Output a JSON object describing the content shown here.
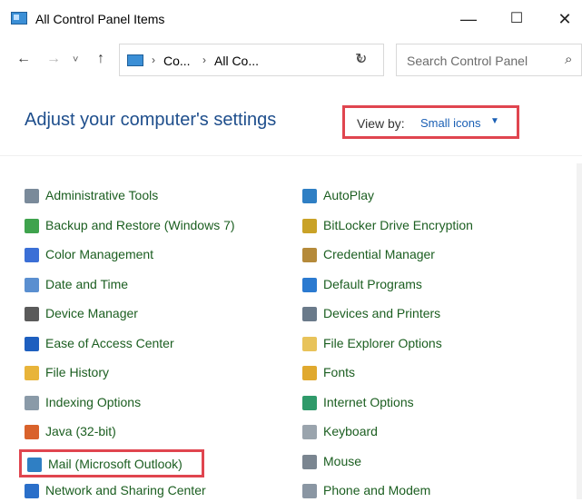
{
  "window": {
    "title": "All Control Panel Items",
    "minimize_glyph": "—",
    "maximize_glyph": "☐",
    "close_glyph": "✕"
  },
  "nav": {
    "back_glyph": "←",
    "forward_glyph": "→",
    "recent_glyph": "˅",
    "up_glyph": "↑",
    "breadcrumbs": [
      "Co...",
      "All Co..."
    ],
    "separator": "›",
    "dropdown_glyph": "˅",
    "refresh_glyph": "↻",
    "search_placeholder": "Search Control Panel",
    "search_glyph": "⌕"
  },
  "header": {
    "title": "Adjust your computer's settings",
    "view_by_label": "View by:",
    "view_by_value": "Small icons",
    "view_by_caret": "▼"
  },
  "accent_color": "#e0454f",
  "items_left": [
    {
      "label": "Administrative Tools",
      "icon": "administrative-tools-icon",
      "color": "#7a8a9a"
    },
    {
      "label": "Backup and Restore (Windows 7)",
      "icon": "backup-restore-icon",
      "color": "#3fa34d"
    },
    {
      "label": "Color Management",
      "icon": "color-management-icon",
      "color": "#3b6fd6"
    },
    {
      "label": "Date and Time",
      "icon": "date-time-icon",
      "color": "#5a8fd0"
    },
    {
      "label": "Device Manager",
      "icon": "device-manager-icon",
      "color": "#5a5a5a"
    },
    {
      "label": "Ease of Access Center",
      "icon": "ease-of-access-icon",
      "color": "#1e5fbf"
    },
    {
      "label": "File History",
      "icon": "file-history-icon",
      "color": "#e8b43a"
    },
    {
      "label": "Indexing Options",
      "icon": "indexing-options-icon",
      "color": "#8a9aa8"
    },
    {
      "label": "Java (32-bit)",
      "icon": "java-icon",
      "color": "#d9622b"
    },
    {
      "label": "Mail (Microsoft Outlook)",
      "icon": "mail-icon",
      "color": "#2f7fc4"
    },
    {
      "label": "Network and Sharing Center",
      "icon": "network-sharing-icon",
      "color": "#2a6fc9"
    }
  ],
  "items_right": [
    {
      "label": "AutoPlay",
      "icon": "autoplay-icon",
      "color": "#2f7fc4"
    },
    {
      "label": "BitLocker Drive Encryption",
      "icon": "bitlocker-icon",
      "color": "#c9a227"
    },
    {
      "label": "Credential Manager",
      "icon": "credential-manager-icon",
      "color": "#b58a3a"
    },
    {
      "label": "Default Programs",
      "icon": "default-programs-icon",
      "color": "#2b7ad0"
    },
    {
      "label": "Devices and Printers",
      "icon": "devices-printers-icon",
      "color": "#6a7a8a"
    },
    {
      "label": "File Explorer Options",
      "icon": "file-explorer-options-icon",
      "color": "#e8c35a"
    },
    {
      "label": "Fonts",
      "icon": "fonts-icon",
      "color": "#e0a92e"
    },
    {
      "label": "Internet Options",
      "icon": "internet-options-icon",
      "color": "#2f9a6a"
    },
    {
      "label": "Keyboard",
      "icon": "keyboard-icon",
      "color": "#9aa4ad"
    },
    {
      "label": "Mouse",
      "icon": "mouse-icon",
      "color": "#7a8590"
    },
    {
      "label": "Phone and Modem",
      "icon": "phone-modem-icon",
      "color": "#8a96a3"
    }
  ]
}
